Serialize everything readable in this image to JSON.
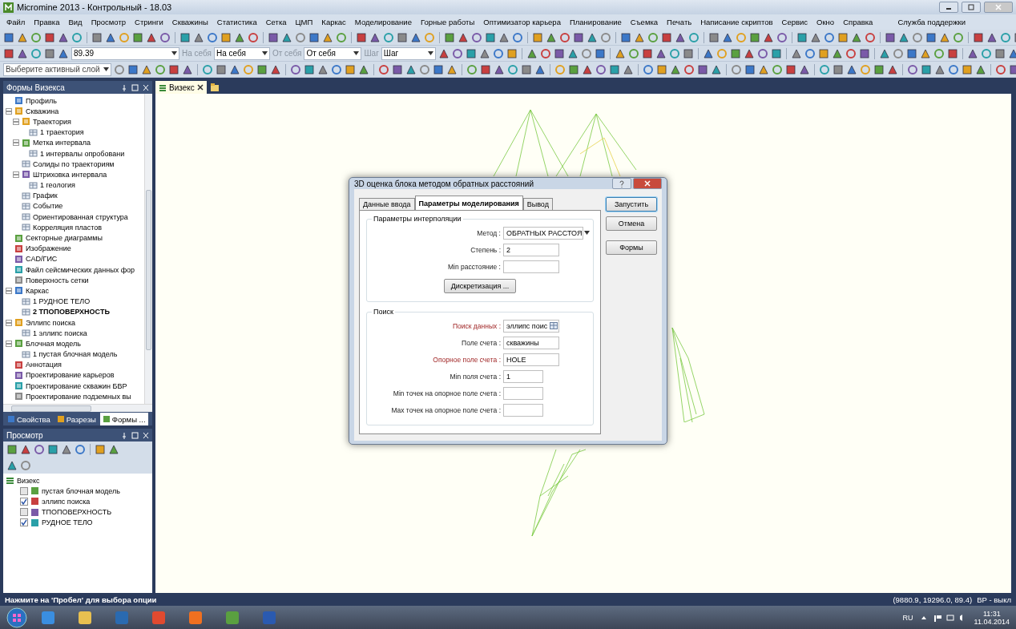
{
  "window": {
    "title": "Micromine 2013 - Контрольный - 18.03"
  },
  "menu": [
    "Файл",
    "Правка",
    "Вид",
    "Просмотр",
    "Стринги",
    "Скважины",
    "Статистика",
    "Сетка",
    "ЦМП",
    "Каркас",
    "Моделирование",
    "Горные работы",
    "Оптимизатор карьера",
    "Планирование",
    "Съемка",
    "Печать",
    "Написание скриптов",
    "Сервис",
    "Окно",
    "Справка"
  ],
  "support_menu": "Служба поддержки",
  "toolbar": {
    "angle": "89.39",
    "toward": {
      "label": "На себя",
      "value": "На себя"
    },
    "away": {
      "label": "От себя",
      "value": "От себя"
    },
    "step": {
      "label": "Шаг",
      "value": "Шаг"
    },
    "layer": {
      "placeholder": "Выберите активный слой"
    }
  },
  "forms_panel": {
    "title": "Формы Визекса",
    "tree": [
      {
        "label": "Профиль",
        "active": false
      },
      {
        "label": "Скважина",
        "active": false,
        "expanded": true,
        "children": [
          {
            "label": "Траектория",
            "active": false,
            "expanded": true,
            "children": [
              {
                "label": "1 траектория",
                "active": false
              }
            ]
          },
          {
            "label": "Метка  интервала",
            "active": false,
            "expanded": true,
            "children": [
              {
                "label": "1 интервалы опробовани",
                "active": false
              }
            ]
          },
          {
            "label": "Солиды по траекториям",
            "active": false
          },
          {
            "label": "Штриховка интервала",
            "active": false,
            "expanded": true,
            "children": [
              {
                "label": "1 геология",
                "active": false
              }
            ]
          },
          {
            "label": "График",
            "active": false
          },
          {
            "label": "Событие",
            "active": false
          },
          {
            "label": "Ориентированная структура",
            "active": false
          },
          {
            "label": "Корреляция пластов",
            "active": false
          }
        ]
      },
      {
        "label": "Секторные диаграммы",
        "active": false
      },
      {
        "label": "Изображение",
        "active": false
      },
      {
        "label": "CAD/ГИС",
        "active": false
      },
      {
        "label": "Файл сейсмических данных фор",
        "active": false
      },
      {
        "label": "Поверхность сетки",
        "active": false
      },
      {
        "label": "Каркас",
        "active": false,
        "expanded": true,
        "children": [
          {
            "label": "1 РУДНОЕ ТЕЛО",
            "active": false
          },
          {
            "label": "2 ТПОПОВЕРХНОСТЬ",
            "active": true
          }
        ]
      },
      {
        "label": "Эллипс поиска",
        "active": false,
        "expanded": true,
        "children": [
          {
            "label": "1 эллипс поиска",
            "active": false
          }
        ]
      },
      {
        "label": "Блочная модель",
        "active": false,
        "expanded": true,
        "children": [
          {
            "label": "1 пустая блочная модель",
            "active": false
          }
        ]
      },
      {
        "label": "Аннотация",
        "active": false
      },
      {
        "label": "Проектирование карьеров",
        "active": false
      },
      {
        "label": "Проектирование скважин БВР",
        "active": false
      },
      {
        "label": "Проектирование подземных вы",
        "active": false
      }
    ],
    "tabs": [
      {
        "label": "Свойства",
        "selected": false
      },
      {
        "label": "Разрезы",
        "selected": false
      },
      {
        "label": "Формы ...",
        "selected": true
      }
    ]
  },
  "view_panel": {
    "title": "Просмотр",
    "root": "Визекс",
    "layers": [
      {
        "label": "пустая блочная модель",
        "checked": false
      },
      {
        "label": "эллипс поиска",
        "checked": true
      },
      {
        "label": "ТПОПОВЕРХНОСТЬ",
        "checked": false
      },
      {
        "label": "РУДНОЕ ТЕЛО",
        "checked": true
      }
    ]
  },
  "document_tabs": [
    {
      "label": "Визекс",
      "selected": true
    }
  ],
  "dialog": {
    "title": "3D оценка блока методом обратных расстояний",
    "tabs": [
      {
        "label": "Данные ввода",
        "selected": false
      },
      {
        "label": "Параметры моделирования",
        "selected": true
      },
      {
        "label": "Вывод",
        "selected": false
      }
    ],
    "groups": [
      {
        "title": "Параметры интерполяции",
        "fields": [
          {
            "label": "Метод :",
            "kind": "combo",
            "value": "ОБРАТНЫХ РАССТОЯ",
            "required": false
          },
          {
            "label": "Степень  :",
            "kind": "text",
            "value": "2",
            "required": false
          },
          {
            "label": "Min расстояние :",
            "kind": "text",
            "required": false
          }
        ],
        "button": "Дискретизация ..."
      },
      {
        "title": "Поиск",
        "fields": [
          {
            "label": "Поиск данных :",
            "kind": "lookup",
            "value": "эллипс поис",
            "required": true
          },
          {
            "label": "Поле счета :",
            "kind": "text",
            "value": "скважины",
            "required": false
          },
          {
            "label": "Опорное поле счета :",
            "kind": "text",
            "value": "HOLE",
            "required": true
          },
          {
            "label": "Min поля счета :",
            "kind": "number",
            "value": "1",
            "required": false
          },
          {
            "label": "Min точек на опорное поле счета :",
            "kind": "number",
            "required": false
          },
          {
            "label": "Max точек на опорное поле счета :",
            "kind": "number",
            "required": false
          }
        ]
      }
    ],
    "buttons": [
      {
        "label": "Запустить",
        "default": true
      },
      {
        "label": "Отмена",
        "default": false
      },
      {
        "label": "Формы",
        "default": false
      }
    ]
  },
  "status_bar": {
    "message": "Нажмите на 'Пробел' для выбора опции",
    "coordinates": "(9880.9, 19296.0, 89.4)",
    "mode": "ВР - выкл"
  },
  "taskbar": {
    "language": "RU",
    "time": "11:31",
    "date": "11.04.2014"
  }
}
